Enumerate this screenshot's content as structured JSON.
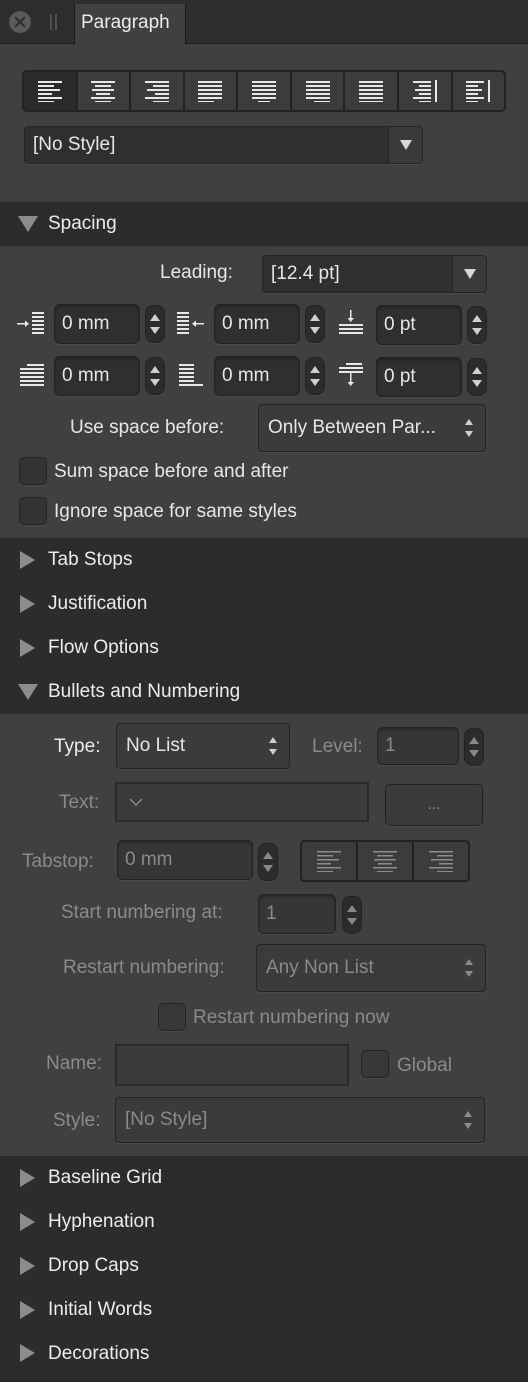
{
  "panel": {
    "tab_label": "Paragraph",
    "close_icon": "close-icon",
    "grip_icon": "grip-icon"
  },
  "alignment": {
    "buttons": [
      {
        "name": "align-left",
        "icon": "align-left-icon",
        "active": true
      },
      {
        "name": "align-center",
        "icon": "align-center-icon",
        "active": false
      },
      {
        "name": "align-right",
        "icon": "align-right-icon",
        "active": false
      },
      {
        "name": "justify-left",
        "icon": "justify-left-icon",
        "active": false
      },
      {
        "name": "justify-center",
        "icon": "justify-center-icon",
        "active": false
      },
      {
        "name": "justify-right",
        "icon": "justify-right-icon",
        "active": false
      },
      {
        "name": "justify-all",
        "icon": "justify-all-icon",
        "active": false
      },
      {
        "name": "align-towards-spine",
        "icon": "align-towards-spine-icon",
        "active": false
      },
      {
        "name": "align-away-from-spine",
        "icon": "align-away-from-spine-icon",
        "active": false
      }
    ]
  },
  "style_dropdown": {
    "value": "[No Style]"
  },
  "spacing": {
    "header": "Spacing",
    "expanded": true,
    "leading_label": "Leading:",
    "leading_value": "[12.4 pt]",
    "left_indent": "0 mm",
    "right_indent": "0 mm",
    "space_before": "0 pt",
    "first_line_indent": "0 mm",
    "last_line_indent": "0 mm",
    "space_after": "0 pt",
    "use_space_before_label": "Use space before:",
    "use_space_before_value": "Only Between Par...",
    "sum_space_label": "Sum space before and after",
    "sum_space_checked": false,
    "ignore_space_label": "Ignore space for same styles",
    "ignore_space_checked": false
  },
  "collapsed_sections_top": [
    {
      "label": "Tab Stops"
    },
    {
      "label": "Justification"
    },
    {
      "label": "Flow Options"
    }
  ],
  "bullets": {
    "header": "Bullets and Numbering",
    "expanded": true,
    "type_label": "Type:",
    "type_value": "No List",
    "level_label": "Level:",
    "level_value": "1",
    "text_label": "Text:",
    "text_value": "",
    "more_button": "...",
    "tabstop_label": "Tabstop:",
    "tabstop_value": "0 mm",
    "start_numbering_label": "Start numbering at:",
    "start_numbering_value": "1",
    "restart_numbering_label": "Restart numbering:",
    "restart_numbering_value": "Any Non List",
    "restart_now_label": "Restart numbering now",
    "restart_now_checked": false,
    "name_label": "Name:",
    "name_value": "",
    "global_label": "Global",
    "global_checked": false,
    "style_label": "Style:",
    "style_value": "[No Style]"
  },
  "collapsed_sections_bottom": [
    {
      "label": "Baseline Grid"
    },
    {
      "label": "Hyphenation"
    },
    {
      "label": "Drop Caps"
    },
    {
      "label": "Initial Words"
    },
    {
      "label": "Decorations"
    }
  ],
  "colors": {
    "panel_bg": "#404040",
    "header_bg": "#2c2c2c",
    "text": "#e6e6e6",
    "dim_text": "#8a8a8a"
  }
}
